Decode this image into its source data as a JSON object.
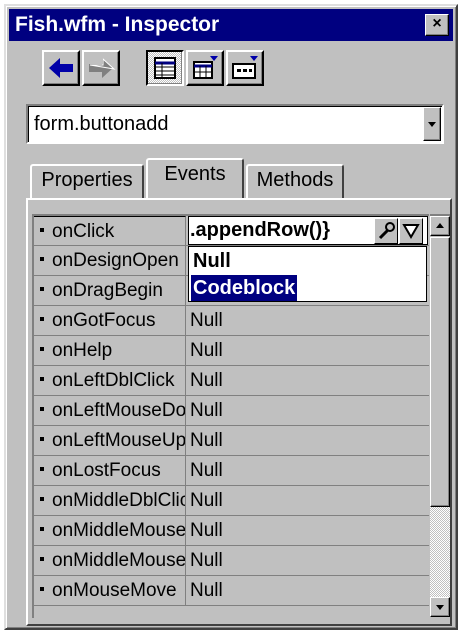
{
  "window": {
    "title": "Fish.wfm - Inspector",
    "close_glyph": "×"
  },
  "toolbar": {
    "back_icon": "left-arrow-icon",
    "forward_icon": "right-arrow-icon",
    "categorized_icon": "list-view-icon",
    "alphabetic_icon": "table-view-icon",
    "outline_icon": "outline-view-icon"
  },
  "object_selector": {
    "value": "form.buttonadd"
  },
  "tabs": [
    {
      "label": "Properties",
      "active": false
    },
    {
      "label": "Events",
      "active": true
    },
    {
      "label": "Methods",
      "active": false
    }
  ],
  "events": [
    {
      "name": "onClick",
      "value": ".appendRow()}"
    },
    {
      "name": "onDesignOpen",
      "value": ""
    },
    {
      "name": "onDragBegin",
      "value": ""
    },
    {
      "name": "onGotFocus",
      "value": "Null"
    },
    {
      "name": "onHelp",
      "value": "Null"
    },
    {
      "name": "onLeftDblClick",
      "value": "Null"
    },
    {
      "name": "onLeftMouseDown",
      "value": "Null"
    },
    {
      "name": "onLeftMouseUp",
      "value": "Null"
    },
    {
      "name": "onLostFocus",
      "value": "Null"
    },
    {
      "name": "onMiddleDblClick",
      "value": "Null"
    },
    {
      "name": "onMiddleMouseDown",
      "value": "Null"
    },
    {
      "name": "onMiddleMouseUp",
      "value": "Null"
    },
    {
      "name": "onMouseMove",
      "value": "Null"
    }
  ],
  "value_dropdown": {
    "options": [
      {
        "label": "Null",
        "selected": false
      },
      {
        "label": "Codeblock",
        "selected": true
      }
    ]
  },
  "colors": {
    "title_bar": "#000080",
    "face": "#c0c0c0",
    "highlight": "#000080",
    "arrow_blue": "#0000a8"
  }
}
